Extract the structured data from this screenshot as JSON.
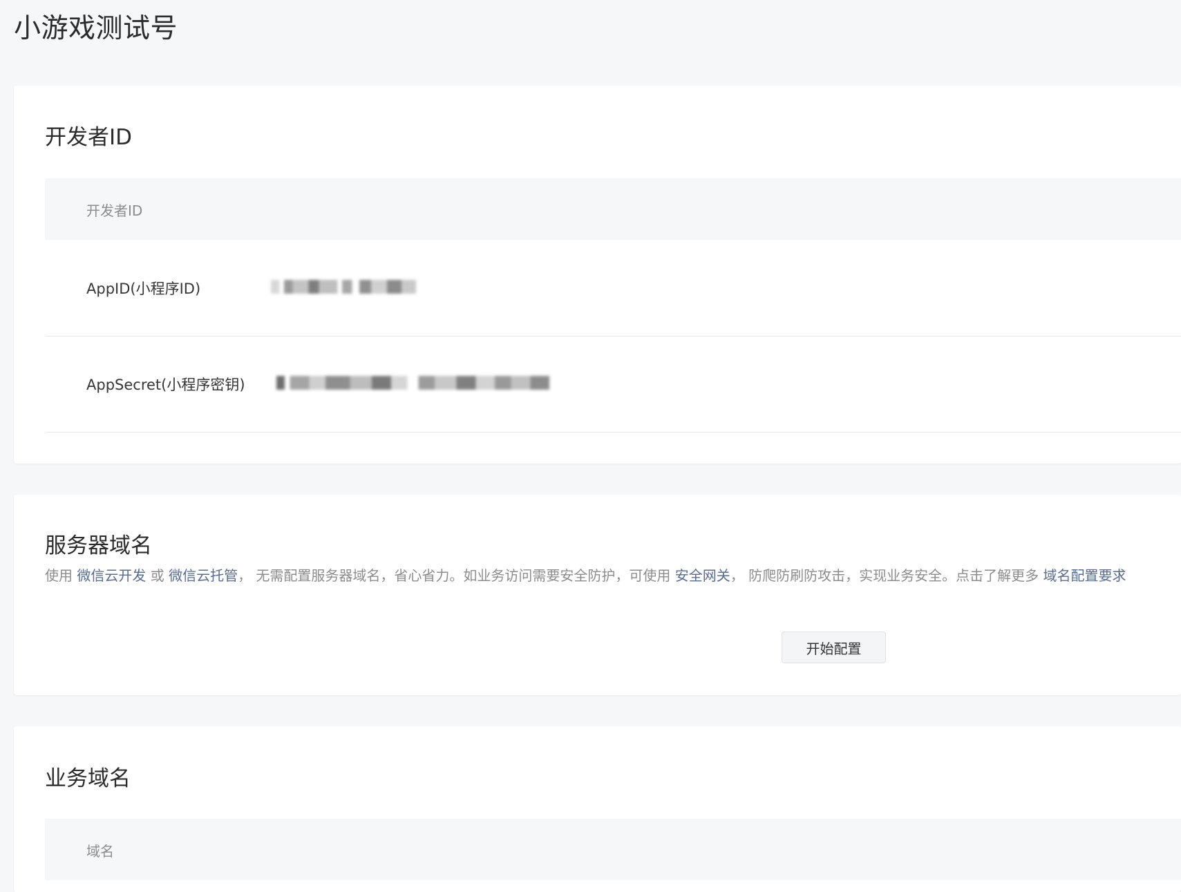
{
  "page": {
    "title": "小游戏测试号"
  },
  "developer_id": {
    "title": "开发者ID",
    "table_header": "开发者ID",
    "rows": [
      {
        "label": "AppID(小程序ID)",
        "value_masked": true
      },
      {
        "label": "AppSecret(小程序密钥)",
        "value_masked": true
      }
    ]
  },
  "server_domain": {
    "title": "服务器域名",
    "desc": {
      "t1": "使用 ",
      "link1": "微信云开发",
      "t2": " 或 ",
      "link2": "微信云托管",
      "t3": "， 无需配置服务器域名，省心省力。如业务访问需要安全防护，可使用 ",
      "link3": "安全网关",
      "t4": "， 防爬防刷防攻击，实现业务安全。点击了解更多 ",
      "link4": "域名配置要求"
    },
    "button_label": "开始配置"
  },
  "business_domain": {
    "title": "业务域名",
    "table_header": "域名"
  },
  "colors": {
    "background": "#f6f7f9",
    "card": "#ffffff",
    "link": "#576b95",
    "muted_text": "#8c8c8c",
    "primary_text": "#353535"
  }
}
